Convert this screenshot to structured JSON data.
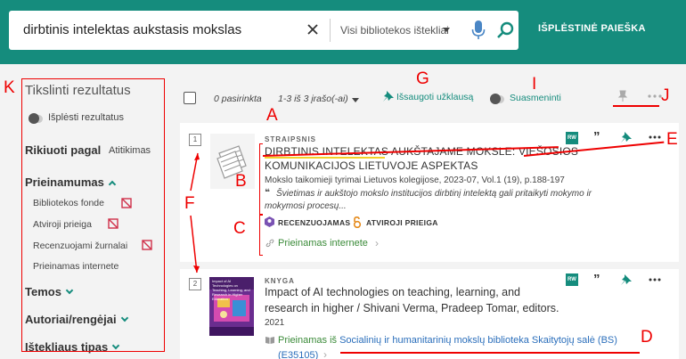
{
  "header": {
    "search_query": "dirbtinis intelektas aukstasis mokslas",
    "scope": "Visi bibliotekos ištekliai",
    "advanced_search": "IŠPLĖSTINĖ PAIEŠKA"
  },
  "sidebar": {
    "title": "Tikslinti rezultatus",
    "expand_label": "Išplėsti rezultatus",
    "sort_label": "Rikiuoti pagal",
    "sort_value": "Atitikimas",
    "availability_head": "Prieinamumas",
    "availability_items": [
      "Bibliotekos fonde",
      "Atviroji prieiga",
      "Recenzuojami žurnalai",
      "Prieinamas internete"
    ],
    "topics_head": "Temos",
    "authors_head": "Autoriai/rengėjai",
    "resource_type_head": "Ištekliaus tipas"
  },
  "toolbar": {
    "selected": "0 pasirinkta",
    "range": "1-3 iš 3 įrašo(-ai)",
    "save_query": "Išsaugoti užklausą",
    "notify": "Suasmeninti"
  },
  "results": [
    {
      "number": "1",
      "type": "STRAIPSNIS",
      "title_line1": "DIRBTINIS INTELEKTAS AUKŠTAJAME MOKSLE: VIEŠOSIOS",
      "title_line2": "KOMUNIKACIJOS LIETUVOJE ASPEKTAS",
      "source": "Mokslo taikomieji tyrimai Lietuvos kolegijose, 2023-07, Vol.1 (19), p.188-197",
      "snippet_line1": "Švietimas ir aukštojo mokslo institucijos dirbtinį intelektą gali pritaikyti mokymo ir",
      "snippet_line2": "mokymosi procesų...",
      "badge_reviewed": "RECENZUOJAMAS",
      "badge_open": "ATVIROJI PRIEIGA",
      "availability": "Prieinamas internete",
      "rw": "RW"
    },
    {
      "number": "2",
      "type": "KNYGA",
      "title_line1": "Impact of AI technologies on teaching, learning, and",
      "title_line2": "research in higher / Shivani Verma, Pradeep Tomar, editors.",
      "year": "2021",
      "availability_prefix": "Prieinamas iš",
      "availability_location": "Socialinių ir humanitarinių mokslų biblioteka  Skaitytojų salė (BS)",
      "call_number": "(E35105)",
      "rw": "RW",
      "cover_title": "Impact of AI Technologies on Teaching, Learning, and Research in Higher Education"
    }
  ],
  "annotations": [
    "A",
    "B",
    "C",
    "D",
    "E",
    "F",
    "G",
    "I",
    "J",
    "K"
  ],
  "colors": {
    "header_bg": "#158c7d",
    "accent": "#158c7d",
    "annotation": "#e00000",
    "link": "#2a6ebb",
    "available": "#3a8a38"
  }
}
